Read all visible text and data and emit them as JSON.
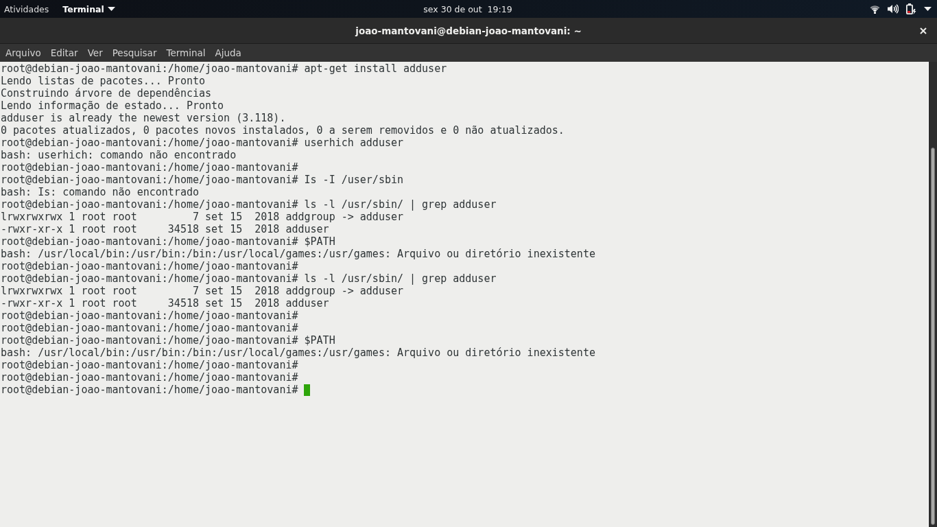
{
  "top_bar": {
    "activities": "Atividades",
    "app_menu": "Terminal",
    "clock": "sex 30 de out  19:19"
  },
  "window": {
    "title": "joao-mantovani@debian-joao-mantovani: ~"
  },
  "menu_bar": [
    "Arquivo",
    "Editar",
    "Ver",
    "Pesquisar",
    "Terminal",
    "Ajuda"
  ],
  "terminal": {
    "lines": [
      "root@debian-joao-mantovani:/home/joao-mantovani# apt-get install adduser",
      "Lendo listas de pacotes... Pronto",
      "Construindo árvore de dependências",
      "Lendo informação de estado... Pronto",
      "adduser is already the newest version (3.118).",
      "0 pacotes atualizados, 0 pacotes novos instalados, 0 a serem removidos e 0 não atualizados.",
      "root@debian-joao-mantovani:/home/joao-mantovani# userhich adduser",
      "bash: userhich: comando não encontrado",
      "root@debian-joao-mantovani:/home/joao-mantovani#",
      "root@debian-joao-mantovani:/home/joao-mantovani# Is -I /user/sbin",
      "bash: Is: comando não encontrado",
      "root@debian-joao-mantovani:/home/joao-mantovani# ls -l /usr/sbin/ | grep adduser",
      "lrwxrwxrwx 1 root root         7 set 15  2018 addgroup -> adduser",
      "-rwxr-xr-x 1 root root     34518 set 15  2018 adduser",
      "root@debian-joao-mantovani:/home/joao-mantovani# $PATH",
      "bash: /usr/local/bin:/usr/bin:/bin:/usr/local/games:/usr/games: Arquivo ou diretório inexistente",
      "root@debian-joao-mantovani:/home/joao-mantovani#",
      "root@debian-joao-mantovani:/home/joao-mantovani# ls -l /usr/sbin/ | grep adduser",
      "lrwxrwxrwx 1 root root         7 set 15  2018 addgroup -> adduser",
      "-rwxr-xr-x 1 root root     34518 set 15  2018 adduser",
      "root@debian-joao-mantovani:/home/joao-mantovani#",
      "root@debian-joao-mantovani:/home/joao-mantovani#",
      "root@debian-joao-mantovani:/home/joao-mantovani# $PATH",
      "bash: /usr/local/bin:/usr/bin:/bin:/usr/local/games:/usr/games: Arquivo ou diretório inexistente",
      "root@debian-joao-mantovani:/home/joao-mantovani#",
      "root@debian-joao-mantovani:/home/joao-mantovani#",
      "root@debian-joao-mantovani:/home/joao-mantovani#"
    ],
    "cursor": true
  }
}
